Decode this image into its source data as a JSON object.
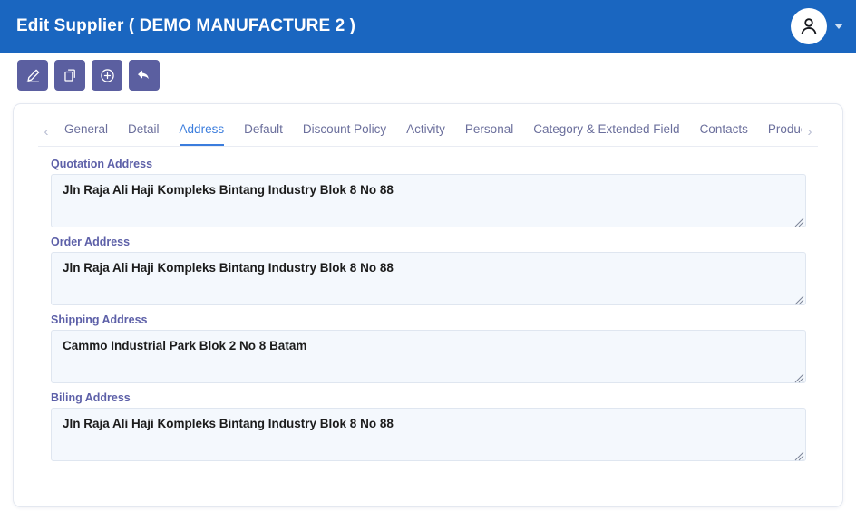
{
  "header": {
    "title": "Edit Supplier ( DEMO MANUFACTURE 2 )",
    "brand_color": "#1a66c0",
    "avatar_icon": "user-icon",
    "caret_icon": "chevron-down-icon"
  },
  "toolbar": {
    "buttons": [
      {
        "name": "edit-button",
        "icon": "pencil-icon",
        "tooltip": "Edit"
      },
      {
        "name": "duplicate-button",
        "icon": "copy-icon",
        "tooltip": "Copy"
      },
      {
        "name": "add-button",
        "icon": "plus-circle-icon",
        "tooltip": "Add"
      },
      {
        "name": "back-button",
        "icon": "undo-arrow-icon",
        "tooltip": "Back"
      }
    ],
    "button_color": "#5b5fa0"
  },
  "tabs": {
    "prev_arrow": "‹",
    "next_arrow": "›",
    "active_color": "#3b7ddd",
    "inactive_color": "#6b6f9c",
    "items": [
      {
        "label": "General",
        "active": false
      },
      {
        "label": "Detail",
        "active": false
      },
      {
        "label": "Address",
        "active": true
      },
      {
        "label": "Default",
        "active": false
      },
      {
        "label": "Discount Policy",
        "active": false
      },
      {
        "label": "Activity",
        "active": false
      },
      {
        "label": "Personal",
        "active": false
      },
      {
        "label": "Category & Extended Field",
        "active": false
      },
      {
        "label": "Contacts",
        "active": false
      },
      {
        "label": "Product Category",
        "active": false,
        "truncated": true
      }
    ]
  },
  "form": {
    "fields": [
      {
        "name": "quotation-address",
        "label": "Quotation Address",
        "value": "Jln Raja Ali Haji Kompleks Bintang Industry Blok 8 No 88",
        "placeholder": ""
      },
      {
        "name": "order-address",
        "label": "Order Address",
        "value": "Jln Raja Ali Haji Kompleks Bintang Industry Blok 8 No 88",
        "placeholder": ""
      },
      {
        "name": "shipping-address",
        "label": "Shipping Address",
        "value": "Cammo Industrial Park Blok 2 No 8 Batam",
        "placeholder": ""
      },
      {
        "name": "biling-address",
        "label": "Biling Address",
        "value": "Jln Raja Ali Haji Kompleks Bintang Industry Blok 8 No 88",
        "placeholder": ""
      }
    ]
  }
}
